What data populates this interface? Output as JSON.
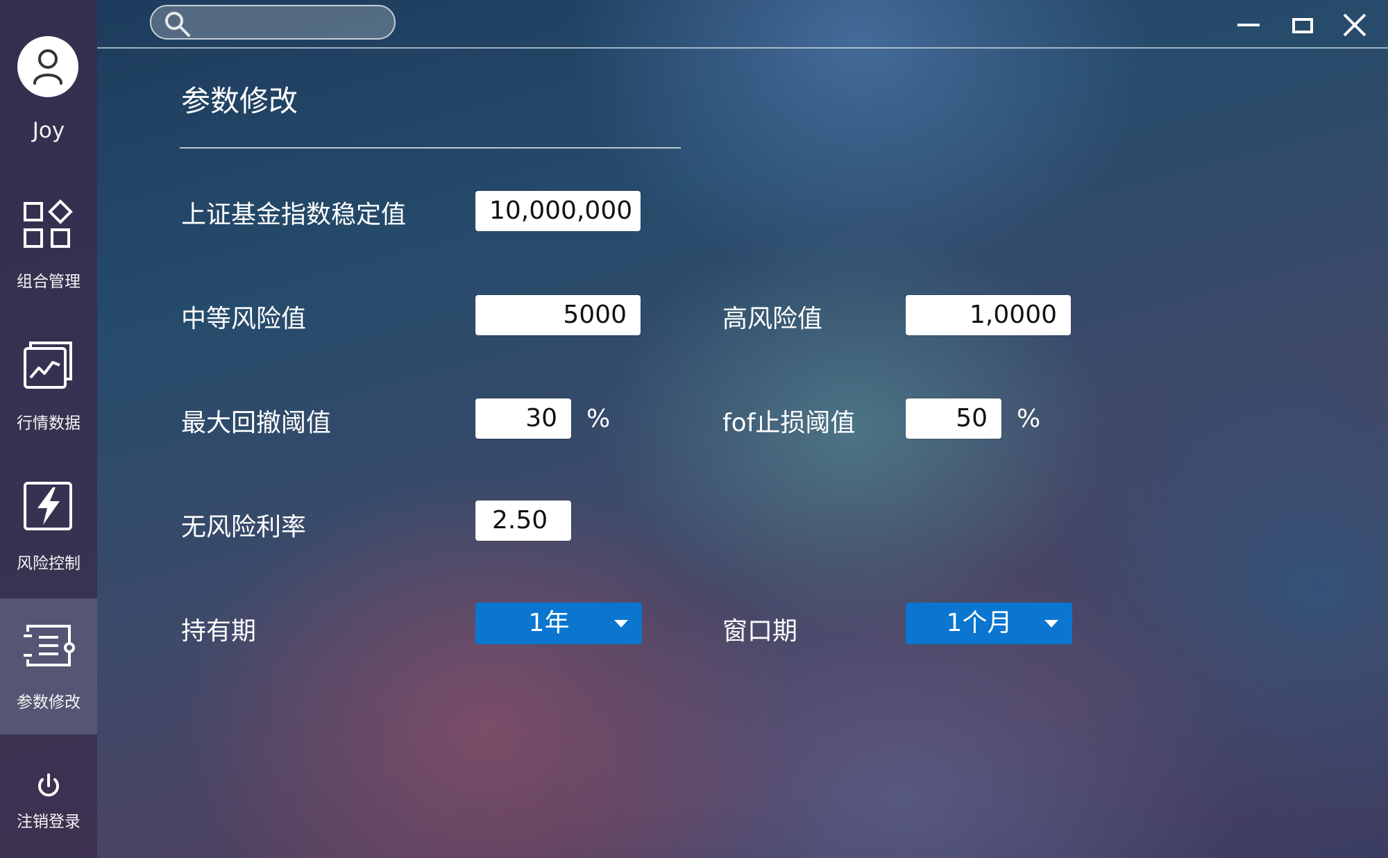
{
  "user": {
    "name": "Joy"
  },
  "search": {
    "placeholder": ""
  },
  "sidebar": {
    "items": [
      {
        "label": "组合管理",
        "icon": "portfolio-grid-icon",
        "active": false
      },
      {
        "label": "行情数据",
        "icon": "market-chart-icon",
        "active": false
      },
      {
        "label": "风险控制",
        "icon": "lightning-icon",
        "active": false
      },
      {
        "label": "参数修改",
        "icon": "settings-list-icon",
        "active": true
      }
    ],
    "logout_label": "注销登录"
  },
  "page": {
    "title": "参数修改"
  },
  "params": {
    "index_stable": {
      "label": "上证基金指数稳定值",
      "value": "10,000,000"
    },
    "medium_risk": {
      "label": "中等风险值",
      "value": "5000"
    },
    "high_risk": {
      "label": "高风险值",
      "value": "1,0000"
    },
    "max_drawdown": {
      "label": "最大回撤阈值",
      "value": "30",
      "unit": "%"
    },
    "fof_stop_loss": {
      "label": "fof止损阈值",
      "value": "50",
      "unit": "%"
    },
    "risk_free_rate": {
      "label": "无风险利率",
      "value": "2.50"
    },
    "holding_period": {
      "label": "持有期",
      "value": "1年"
    },
    "window_period": {
      "label": "窗口期",
      "value": "1个月"
    }
  },
  "colors": {
    "accent": "#0a76cf",
    "sidebar": "#3a2c4a"
  }
}
